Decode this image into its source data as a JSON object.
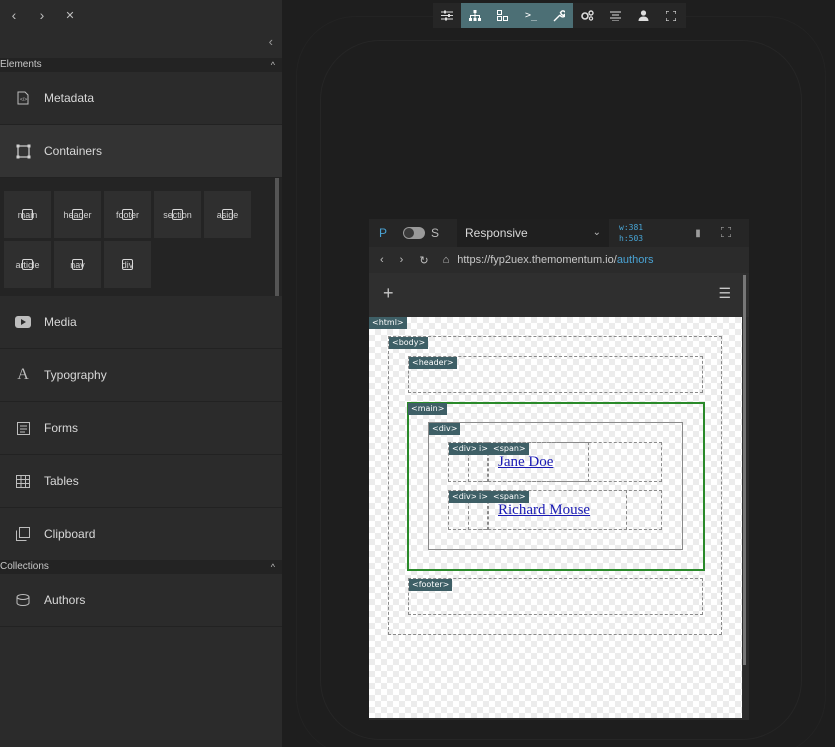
{
  "nav": {
    "back": "‹",
    "forward": "›",
    "close": "✕",
    "collapse": "‹"
  },
  "sections": {
    "elements": {
      "label": "Elements",
      "caret": "^"
    },
    "collections": {
      "label": "Collections",
      "caret": "^"
    }
  },
  "elements": [
    {
      "label": "Metadata",
      "icon": "metadata-icon"
    },
    {
      "label": "Containers",
      "icon": "containers-icon"
    },
    {
      "label": "Media",
      "icon": "youtube-icon"
    },
    {
      "label": "Typography",
      "icon": "typography-icon"
    },
    {
      "label": "Forms",
      "icon": "forms-icon"
    },
    {
      "label": "Tables",
      "icon": "table-icon"
    },
    {
      "label": "Clipboard",
      "icon": "clipboard-icon"
    }
  ],
  "containers": [
    "main",
    "header",
    "footer",
    "section",
    "aside",
    "article",
    "nav",
    "div"
  ],
  "collections": [
    {
      "label": "Authors",
      "icon": "database-icon"
    }
  ],
  "preview": {
    "p": "P",
    "s": "S",
    "viewport": "Responsive",
    "width": "w:381",
    "height": "h:503",
    "url_base": "https://fyp2uex.themomentum.io/",
    "url_path": "authors"
  },
  "tags": {
    "html": "<html>",
    "body": "<body>",
    "header": "<header>",
    "main": "<main>",
    "div": "<div>",
    "i": "i>",
    "span": "<span>",
    "footer": "<footer>"
  },
  "authors": [
    "Jane Doe",
    "Richard Mouse"
  ],
  "colors": {
    "accent": "#4aa3d4",
    "tag_bg": "#3e5f66",
    "main_outline": "#2a8a2a",
    "link": "#1a1ab4"
  }
}
